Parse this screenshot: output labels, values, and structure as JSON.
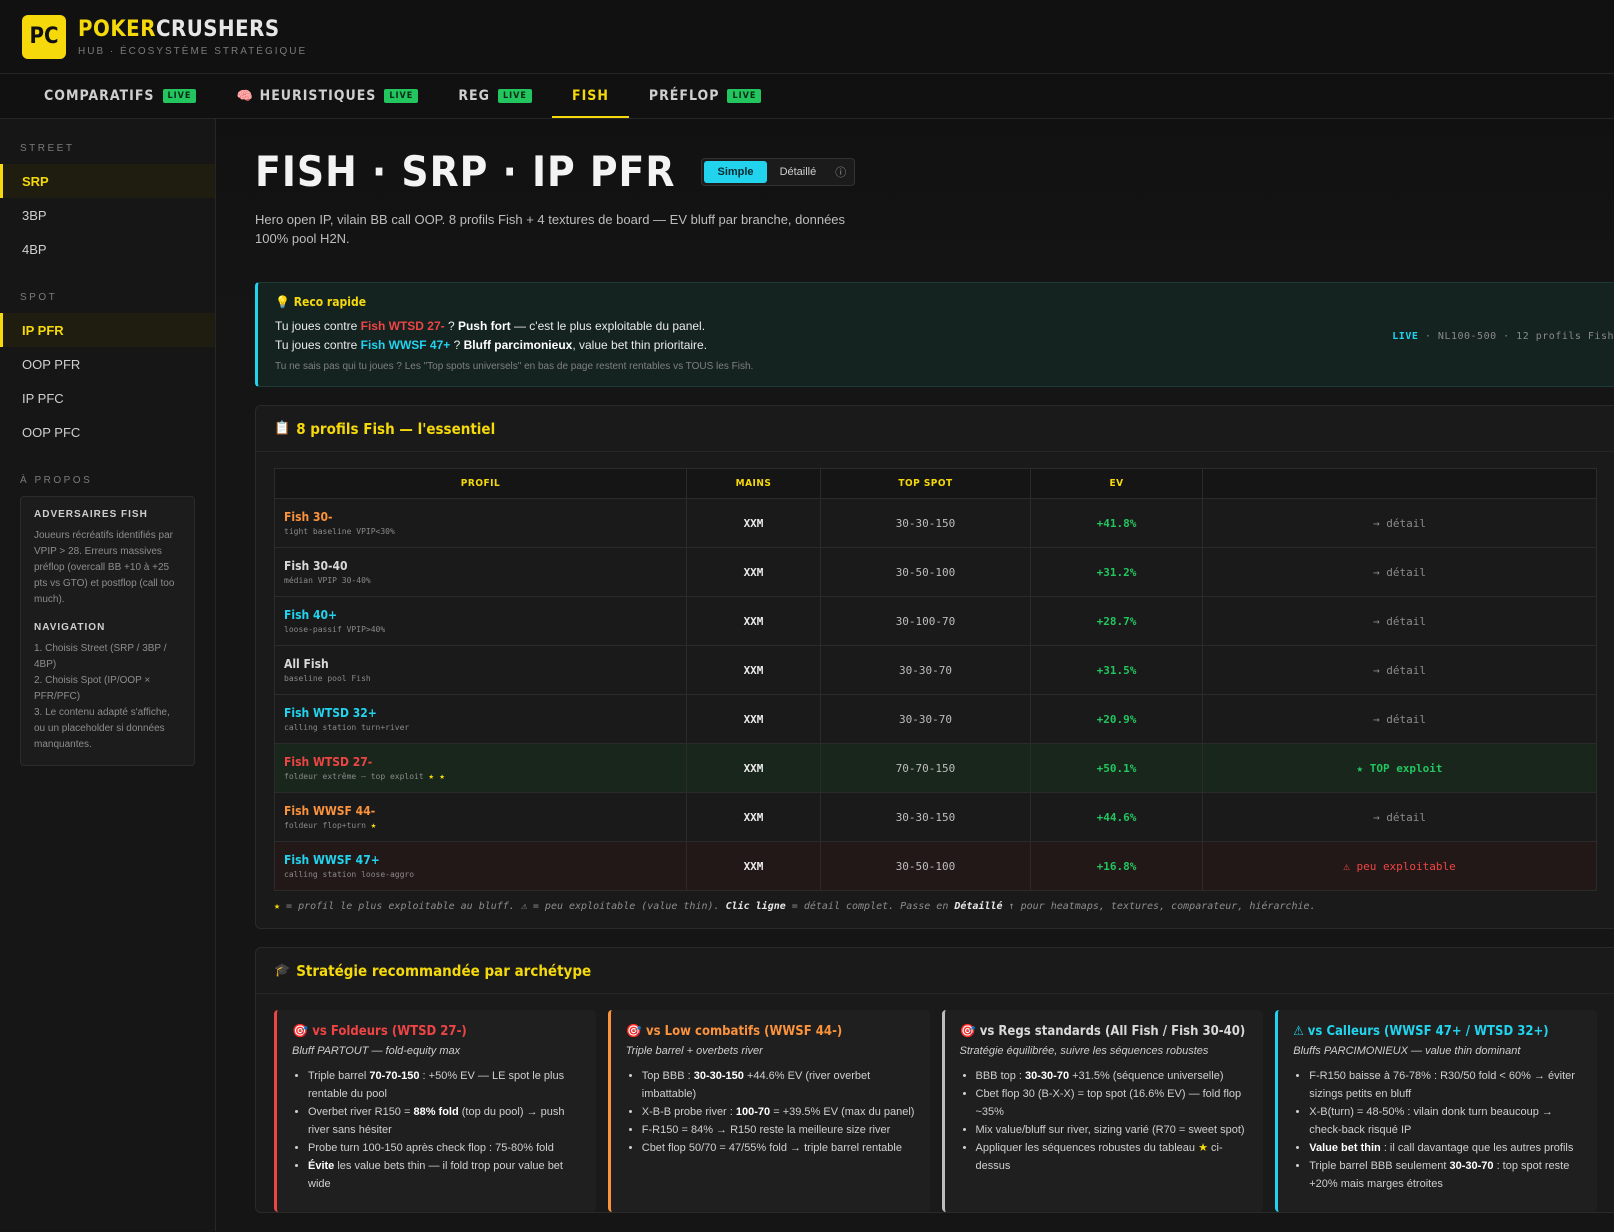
{
  "brand": {
    "logo": "PC",
    "name_a": "POKER",
    "name_b": "CRUSHERS",
    "subtitle": "HUB · ÉCOSYSTÈME STRATÉGIQUE"
  },
  "nav": [
    {
      "label": "COMPARATIFS",
      "badge": "LIVE",
      "icon": ""
    },
    {
      "label": "HEURISTIQUES",
      "badge": "LIVE",
      "icon": "🧠"
    },
    {
      "label": "REG",
      "badge": "LIVE",
      "icon": ""
    },
    {
      "label": "FISH",
      "badge": "",
      "icon": ""
    },
    {
      "label": "PRÉFLOP",
      "badge": "LIVE",
      "icon": ""
    }
  ],
  "sidebar": {
    "street_label": "STREET",
    "streets": [
      "SRP",
      "3BP",
      "4BP"
    ],
    "spot_label": "SPOT",
    "spots": [
      "IP PFR",
      "OOP PFR",
      "IP PFC",
      "OOP PFC"
    ],
    "about_label": "À PROPOS",
    "about_title": "ADVERSAIRES FISH",
    "about_text": "Joueurs récréatifs identifiés par VPIP > 28. Erreurs massives préflop (overcall BB +10 à +25 pts vs GTO) et postflop (call too much).",
    "nav_title": "NAVIGATION",
    "nav_steps": [
      "1. Choisis Street (SRP / 3BP / 4BP)",
      "2. Choisis Spot (IP/OOP × PFR/PFC)",
      "3. Le contenu adapté s'affiche, ou un placeholder si données manquantes."
    ]
  },
  "page": {
    "title": "FISH · SRP · IP PFR",
    "toggle_simple": "Simple",
    "toggle_detail": "Détaillé",
    "toggle_info": "ⓘ",
    "description": "Hero open IP, vilain BB call OOP. 8 profils Fish + 4 textures de board — EV bluff par branche, données 100% pool H2N.",
    "status_live": "LIVE",
    "status_rest": " · NL100-500 · 12 profils Fish"
  },
  "reco": {
    "title": "Reco rapide",
    "l1_a": "Tu joues contre ",
    "l1_fish": "Fish WTSD 27-",
    "l1_b": " ? ",
    "l1_bold": "Push fort",
    "l1_c": " — c'est le plus exploitable du panel.",
    "l2_a": "Tu joues contre ",
    "l2_fish": "Fish WWSF 47+",
    "l2_b": " ? ",
    "l2_bold": "Bluff parcimonieux",
    "l2_c": ", value bet thin prioritaire.",
    "note": "Tu ne sais pas qui tu joues ? Les \"Top spots universels\" en bas de page restent rentables vs TOUS les Fish."
  },
  "profiles_card": {
    "title": "8 profils Fish — l'essentiel",
    "headers": [
      "PROFIL",
      "MAINS",
      "TOP SPOT",
      "EV",
      ""
    ],
    "rows": [
      {
        "name": "Fish 30-",
        "sub": "tight baseline VPIP<30%",
        "stars": "",
        "mains": "XXM",
        "seq": "30-30-150",
        "ev": "+41.8%",
        "action": "→ détail",
        "color": "#fb923c",
        "kind": "normal"
      },
      {
        "name": "Fish 30-40",
        "sub": "médian VPIP 30-40%",
        "stars": "",
        "mains": "XXM",
        "seq": "30-50-100",
        "ev": "+31.2%",
        "action": "→ détail",
        "color": "#d8d8d8",
        "kind": "normal"
      },
      {
        "name": "Fish 40+",
        "sub": "loose-passif VPIP>40%",
        "stars": "",
        "mains": "XXM",
        "seq": "30-100-70",
        "ev": "+28.7%",
        "action": "→ détail",
        "color": "#22d3ee",
        "kind": "normal"
      },
      {
        "name": "All Fish",
        "sub": "baseline pool Fish",
        "stars": "",
        "mains": "XXM",
        "seq": "30-30-70",
        "ev": "+31.5%",
        "action": "→ détail",
        "color": "#d8d8d8",
        "kind": "normal"
      },
      {
        "name": "Fish WTSD 32+",
        "sub": "calling station turn+river",
        "stars": "",
        "mains": "XXM",
        "seq": "30-30-70",
        "ev": "+20.9%",
        "action": "→ détail",
        "color": "#22d3ee",
        "kind": "normal"
      },
      {
        "name": "Fish WTSD 27-",
        "sub": "foldeur extrême — top exploit",
        "stars": "★ ★",
        "mains": "XXM",
        "seq": "70-70-150",
        "ev": "+50.1%",
        "action": "★ TOP exploit",
        "color": "#ef4444",
        "kind": "top"
      },
      {
        "name": "Fish WWSF 44-",
        "sub": "foldeur flop+turn",
        "stars": "★",
        "mains": "XXM",
        "seq": "30-30-150",
        "ev": "+44.6%",
        "action": "→ détail",
        "color": "#fb923c",
        "kind": "normal"
      },
      {
        "name": "Fish WWSF 47+",
        "sub": "calling station loose-aggro",
        "stars": "",
        "mains": "XXM",
        "seq": "30-50-100",
        "ev": "+16.8%",
        "action": "⚠ peu exploitable",
        "color": "#22d3ee",
        "kind": "peu"
      }
    ],
    "legend_a": "★",
    "legend_b": " = profil le plus exploitable au bluff. ⚠ = peu exploitable (value thin). ",
    "legend_c": "Clic ligne",
    "legend_d": " = détail complet. Passe en ",
    "legend_e": "Détaillé",
    "legend_f": " ↑ pour heatmaps, textures, comparateur, hiérarchie."
  },
  "strategy_card": {
    "title": "Stratégie recommandée par archétype",
    "cards": [
      {
        "title": "🎯 vs Foldeurs (WTSD 27-)",
        "sub": "Bluff PARTOUT — fold-equity max",
        "color": "#ef4444"
      },
      {
        "title": "🎯 vs Low combatifs (WWSF 44-)",
        "sub": "Triple barrel + overbets river",
        "color": "#fb923c"
      },
      {
        "title": "🎯 vs Regs standards (All Fish / Fish 30-40)",
        "sub": "Stratégie équilibrée, suivre les séquences robustes",
        "color": "#bdbdbd"
      },
      {
        "title": "⚠ vs Calleurs (WWSF 47+ / WTSD 32+)",
        "sub": "Bluffs PARCIMONIEUX — value thin dominant",
        "color": "#22d3ee"
      }
    ],
    "c1": {
      "b1a": "Triple barrel ",
      "b1b": "70-70-150",
      "b1c": " : +50% EV — LE spot le plus rentable du pool",
      "b2a": "Overbet river R150 = ",
      "b2b": "88% fold",
      "b2c": " (top du pool) → push river sans hésiter",
      "b3": "Probe turn 100-150 après check flop : 75-80% fold",
      "b4a": "Évite",
      "b4b": " les value bets thin — il fold trop pour value bet wide"
    },
    "c2": {
      "b1a": "Top BBB : ",
      "b1b": "30-30-150",
      "b1c": " +44.6% EV (river overbet imbattable)",
      "b2a": "X-B-B probe river : ",
      "b2b": "100-70",
      "b2c": " = +39.5% EV (max du panel)",
      "b3": "F-R150 = 84% → R150 reste la meilleure size river",
      "b4": "Cbet flop 50/70 = 47/55% fold → triple barrel rentable"
    },
    "c3": {
      "b1a": "BBB top : ",
      "b1b": "30-30-70",
      "b1c": " +31.5% (séquence universelle)",
      "b2": "Cbet flop 30 (B-X-X) = top spot (16.6% EV) — fold flop ~35%",
      "b3": "Mix value/bluff sur river, sizing varié (R70 = sweet spot)",
      "b4a": "Appliquer les séquences robustes du tableau ",
      "b4b": "★",
      "b4c": " ci-dessus"
    },
    "c4": {
      "b1": "F-R150 baisse à 76-78% : R30/50 fold < 60% → éviter sizings petits en bluff",
      "b2": "X-B(turn) = 48-50% : vilain donk turn beaucoup → check-back risqué IP",
      "b3a": "Value bet thin",
      "b3b": " : il call davantage que les autres profils",
      "b4a": "Triple barrel BBB seulement ",
      "b4b": "30-30-70",
      "b4c": " : top spot reste +20% mais marges étroites"
    }
  },
  "colors": {
    "accent": "#f5d90a",
    "cyan": "#22d3ee",
    "green": "#22c55e",
    "red": "#ef4444",
    "orange": "#fb923c"
  }
}
